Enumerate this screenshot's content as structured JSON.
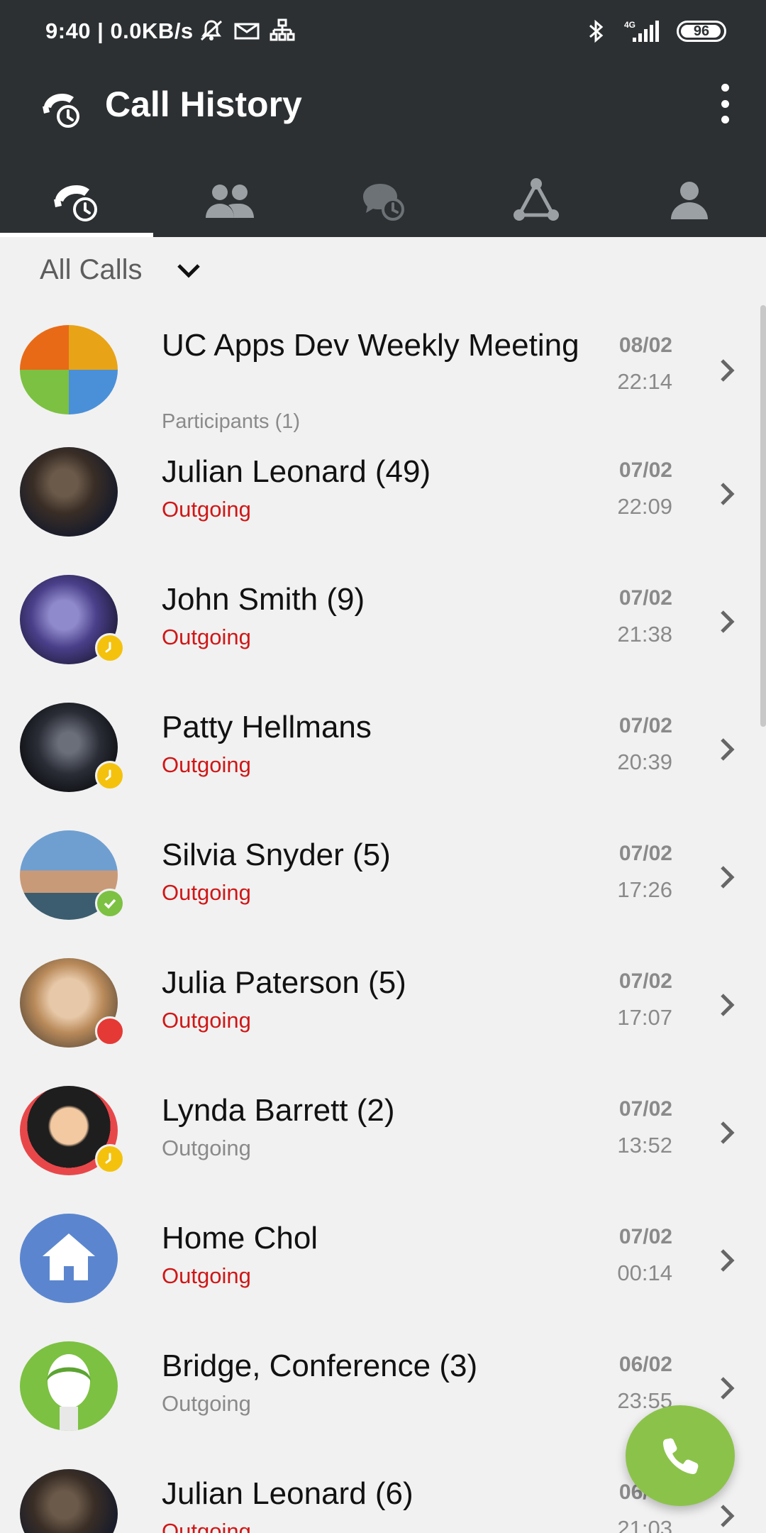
{
  "status_bar": {
    "time": "9:40 | 0.0KB/s",
    "network": "4G",
    "battery": "96"
  },
  "header": {
    "title": "Call History",
    "icon": "call-history-icon",
    "menu_icon": "more-vert-icon"
  },
  "tabs": [
    {
      "icon": "call-history-icon",
      "active": true
    },
    {
      "icon": "contacts-icon",
      "active": false
    },
    {
      "icon": "chat-history-icon",
      "active": false
    },
    {
      "icon": "network-icon",
      "active": false
    },
    {
      "icon": "profile-icon",
      "active": false
    }
  ],
  "filter": {
    "label": "All Calls",
    "icon": "chevron-down-icon"
  },
  "calls": [
    {
      "name": "UC Apps Dev Weekly Meeting",
      "sub": "Participants (1)",
      "sub_color": "#8a8a8a",
      "date": "08/02",
      "time": "22:14",
      "status": "none"
    },
    {
      "name": "Julian Leonard (49)",
      "sub": "Outgoing",
      "sub_color": "#d01616",
      "date": "07/02",
      "time": "22:09",
      "status": "none"
    },
    {
      "name": "John Smith (9)",
      "sub": "Outgoing",
      "sub_color": "#d01616",
      "date": "07/02",
      "time": "21:38",
      "status": "away"
    },
    {
      "name": "Patty Hellmans",
      "sub": "Outgoing",
      "sub_color": "#d01616",
      "date": "07/02",
      "time": "20:39",
      "status": "away"
    },
    {
      "name": "Silvia Snyder (5)",
      "sub": "Outgoing",
      "sub_color": "#d01616",
      "date": "07/02",
      "time": "17:26",
      "status": "available"
    },
    {
      "name": "Julia Paterson (5)",
      "sub": "Outgoing",
      "sub_color": "#d01616",
      "date": "07/02",
      "time": "17:07",
      "status": "busy"
    },
    {
      "name": "Lynda Barrett (2)",
      "sub": "Outgoing",
      "sub_color": "#8a8a8a",
      "date": "07/02",
      "time": "13:52",
      "status": "away"
    },
    {
      "name": "Home Chol",
      "sub": "Outgoing",
      "sub_color": "#d01616",
      "date": "07/02",
      "time": "00:14",
      "status": "none"
    },
    {
      "name": "Bridge, Conference (3)",
      "sub": "Outgoing",
      "sub_color": "#8a8a8a",
      "date": "06/02",
      "time": "23:55",
      "status": "none"
    },
    {
      "name": "Julian Leonard (6)",
      "sub": "Outgoing",
      "sub_color": "#d01616",
      "date": "06/02",
      "time": "21:03",
      "status": "none"
    }
  ],
  "fab": {
    "icon": "phone-icon"
  },
  "colors": {
    "appbar": "#2c3033",
    "accent_green": "#8bc34a",
    "missed_red": "#d01616",
    "away_yellow": "#f4c20d",
    "available_green": "#7cc142",
    "busy_red": "#e53935"
  }
}
